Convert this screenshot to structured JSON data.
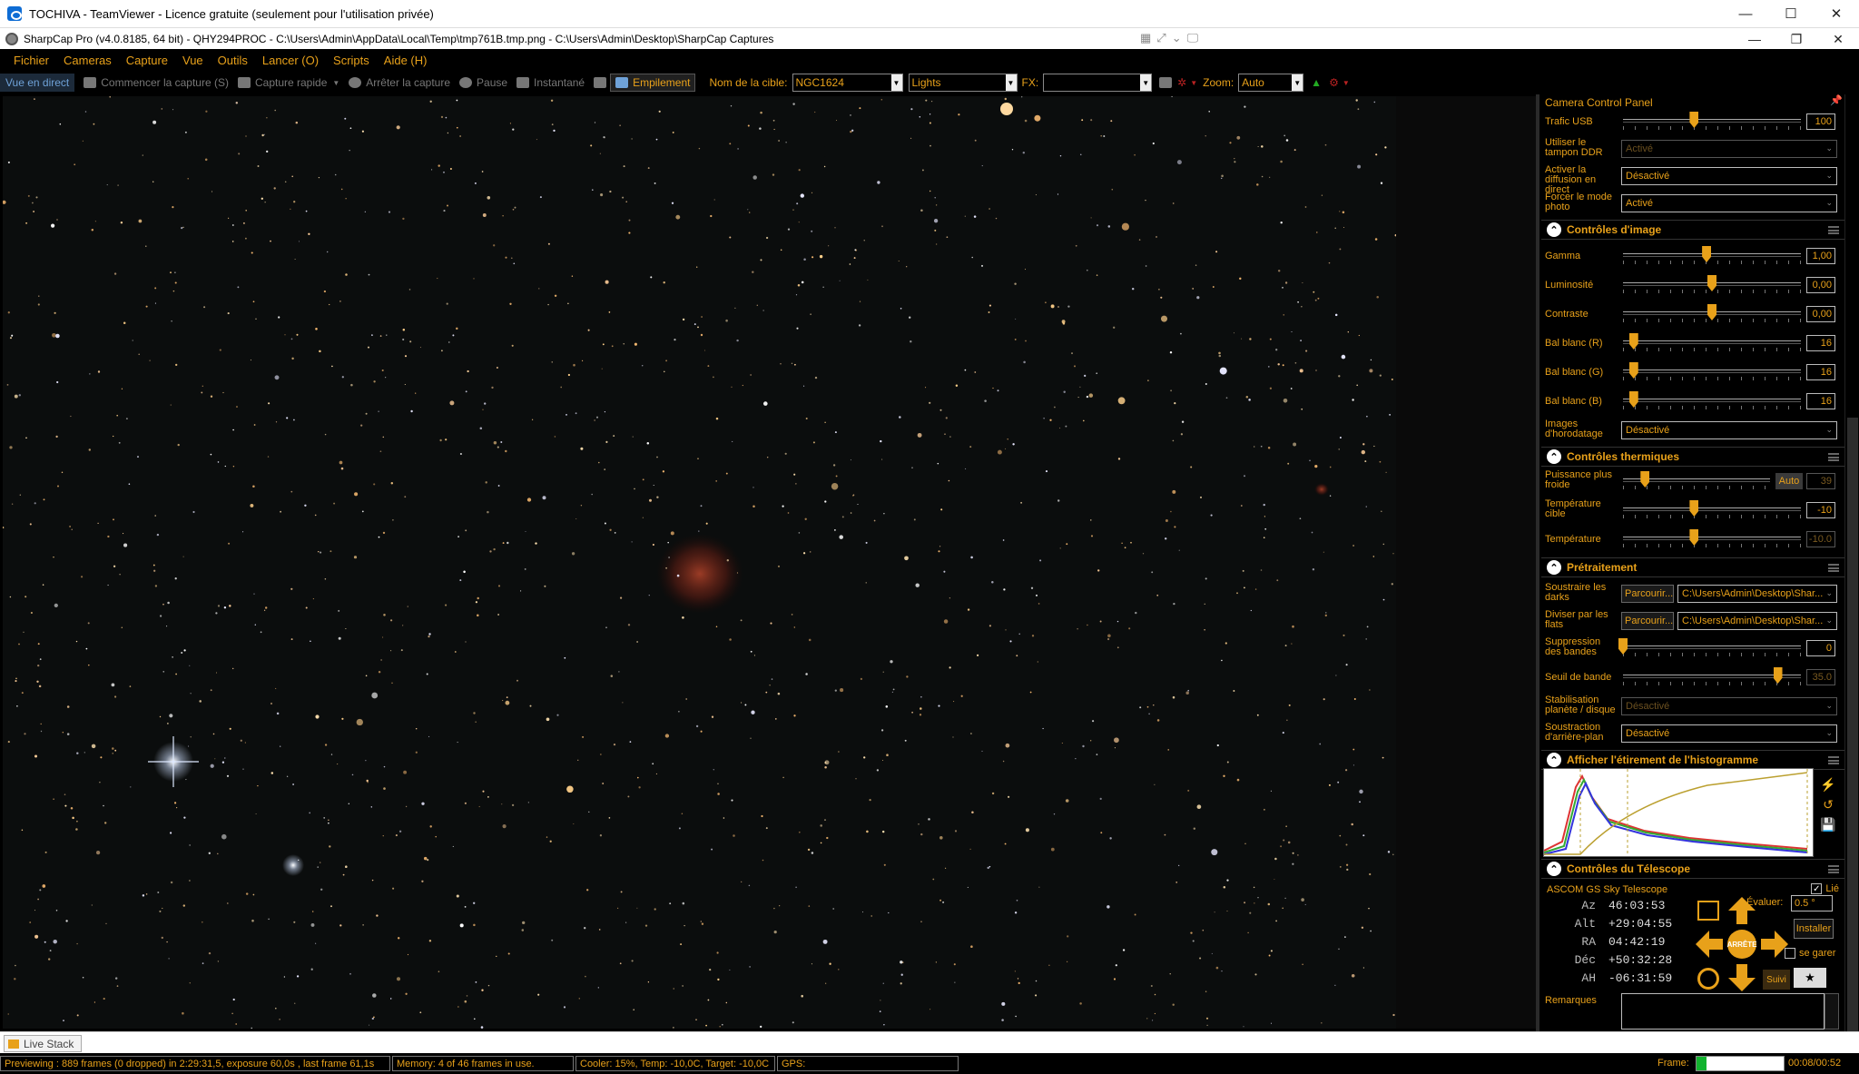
{
  "teamviewer": {
    "title": "TOCHIVA - TeamViewer - Licence gratuite (seulement pour l'utilisation privée)",
    "minimize": "—",
    "maximize": "☐",
    "close": "✕"
  },
  "sharpcap": {
    "title": "SharpCap Pro (v4.0.8185, 64 bit) - QHY294PROC - C:\\Users\\Admin\\AppData\\Local\\Temp\\tmp761B.tmp.png - C:\\Users\\Admin\\Desktop\\SharpCap Captures",
    "minimize": "—",
    "restore": "❐",
    "close": "✕"
  },
  "menu": [
    "Fichier",
    "Cameras",
    "Capture",
    "Vue",
    "Outils",
    "Lancer (O)",
    "Scripts",
    "Aide (H)"
  ],
  "toolbar": {
    "live_view": "Vue en direct",
    "start_capture": "Commencer la capture (S)",
    "quick_capture": "Capture rapide",
    "stop_capture": "Arrêter la capture",
    "pause": "Pause",
    "snapshot": "Instantané",
    "stacking": "Empilement",
    "target_label": "Nom de la cible:",
    "target_value": "NGC1624",
    "frame_type": "Lights",
    "fx_label": "FX:",
    "fx_value": "",
    "zoom_label": "Zoom:",
    "zoom_value": "Auto"
  },
  "panel": {
    "title": "Camera Control Panel",
    "usb_label": "Trafic USB",
    "usb_value": "100",
    "usb_level": 0.4,
    "ddr_label": "Utiliser le tampon DDR",
    "ddr_value": "Activé",
    "stream_label": "Activer la diffusion en direct",
    "stream_value": "Désactivé",
    "photo_label": "Forcer le mode photo",
    "photo_value": "Activé",
    "image_section": "Contrôles d'image",
    "gamma_label": "Gamma",
    "gamma_value": "1,00",
    "gamma_level": 0.47,
    "lum_label": "Luminosité",
    "lum_value": "0,00",
    "lum_level": 0.5,
    "contrast_label": "Contraste",
    "contrast_value": "0,00",
    "contrast_level": 0.5,
    "wbr_label": "Bal blanc (R)",
    "wbr_value": "16",
    "wbr_level": 0.06,
    "wbg_label": "Bal blanc (G)",
    "wbg_value": "16",
    "wbg_level": 0.06,
    "wbb_label": "Bal blanc (B)",
    "wbb_value": "16",
    "wbb_level": 0.06,
    "timestamp_label": "Images d'horodatage",
    "timestamp_value": "Désactivé",
    "thermal_section": "Contrôles thermiques",
    "cooler_label": "Puissance plus froide",
    "cooler_auto": "Auto",
    "cooler_value": "39",
    "cooler_level": 0.15,
    "target_temp_label": "Température cible",
    "target_temp_value": "-10",
    "target_temp_level": 0.4,
    "temp_label": "Température",
    "temp_value": "-10.0",
    "temp_level": 0.4,
    "pre_section": "Prétraitement",
    "darks_label": "Soustraire les darks",
    "darks_button": "Parcourir...",
    "darks_path": "C:\\Users\\Admin\\Desktop\\Shar...",
    "flats_label": "Diviser par les flats",
    "flats_button": "Parcourir...",
    "flats_path": "C:\\Users\\Admin\\Desktop\\Shar...",
    "bands_label": "Suppression des bandes",
    "bands_value": "0",
    "bands_level": 0.0,
    "threshold_label": "Seuil de bande",
    "threshold_value": "35.0",
    "threshold_level": 0.87,
    "stab_label": "Stabilisation planète / disque",
    "stab_value": "Désactivé",
    "bg_label": "Soustraction d'arrière-plan",
    "bg_value": "Désactivé",
    "histo_section": "Afficher l'étirement de l'histogramme",
    "telescope_section": "Contrôles du Télescope",
    "telescope_name": "ASCOM GS Sky Telescope",
    "linked": "Lié",
    "coords": [
      {
        "k": "Az",
        "v": "46:03:53"
      },
      {
        "k": "Alt",
        "v": "+29:04:55"
      },
      {
        "k": "RA",
        "v": "04:42:19"
      },
      {
        "k": "Déc",
        "v": "+50:32:28"
      },
      {
        "k": "AH",
        "v": "-06:31:59"
      }
    ],
    "stop": "ARRÊTE",
    "rate_label": "Évaluer:",
    "rate_value": "0.5 °",
    "install": "Installer",
    "park": "se garer",
    "track": "Suivi",
    "notes_label": "Remarques"
  },
  "tabs": {
    "live_stack": "Live Stack"
  },
  "status": {
    "preview": "Previewing : 889 frames (0 dropped) in 2:29:31,5, exposure 60,0s , last frame 61,1s",
    "memory": "Memory: 4 of 46 frames in use.",
    "cooler": "Cooler: 15%, Temp: -10,0C, Target: -10,0C",
    "gps": "GPS:",
    "frame_label": "Frame:",
    "frame_progress": 0.11,
    "frame_time": "00:08/00:52"
  }
}
